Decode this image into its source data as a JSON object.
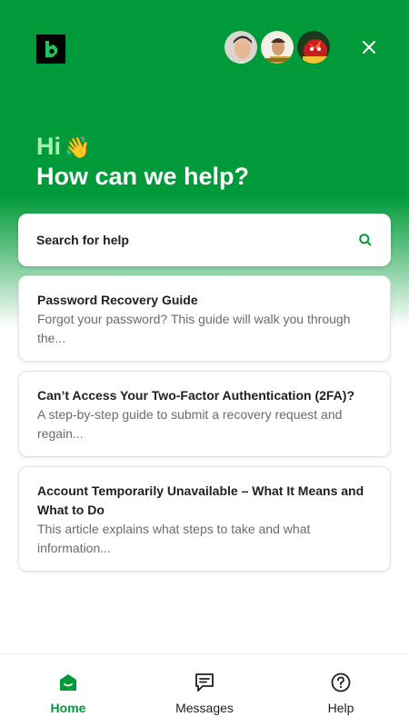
{
  "header": {
    "greeting": "Hi",
    "greeting_emoji": "👋",
    "headline": "How can we help?",
    "logo_icon": "brand-logo-icon",
    "close_icon": "close-icon",
    "avatars": [
      "team-member-avatar-1",
      "team-member-avatar-2",
      "team-member-avatar-3"
    ]
  },
  "search": {
    "label": "Search for help",
    "icon": "search-icon"
  },
  "articles": [
    {
      "title": "Password Recovery Guide",
      "description": "Forgot your password? This guide will walk you through the..."
    },
    {
      "title": "Can’t Access Your Two-Factor Authentication (2FA)?",
      "description": "A step-by-step guide to submit a recovery request and regain..."
    },
    {
      "title": "Account Temporarily Unavailable – What It Means and What to Do",
      "description": "This article explains what steps to take and what information..."
    }
  ],
  "nav": {
    "items": [
      {
        "label": "Home",
        "icon": "home-icon",
        "active": true
      },
      {
        "label": "Messages",
        "icon": "messages-icon",
        "active": false
      },
      {
        "label": "Help",
        "icon": "help-icon",
        "active": false
      }
    ]
  },
  "colors": {
    "brand_green": "#019a3a",
    "greeting_green": "#a9f0a8",
    "card_border": "#e3e3e3"
  }
}
